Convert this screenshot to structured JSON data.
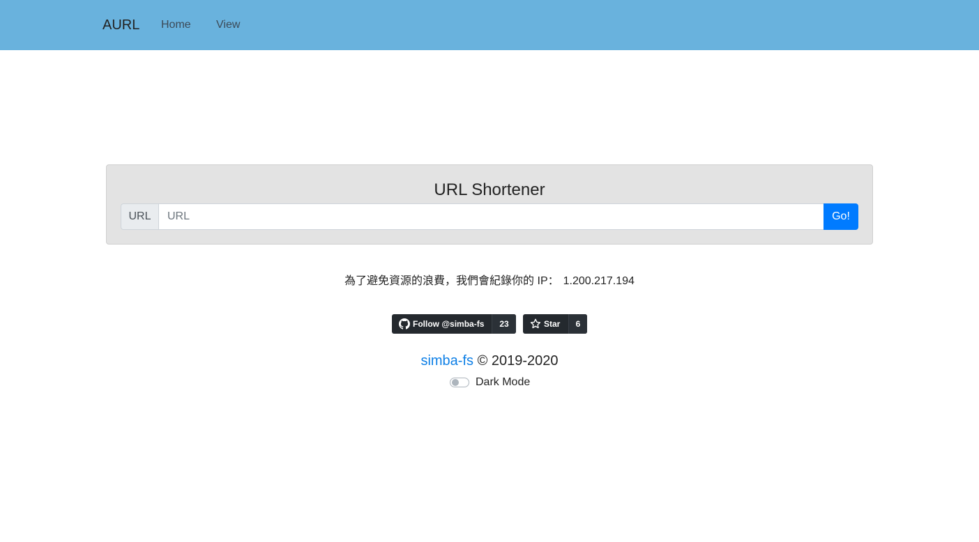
{
  "nav": {
    "brand": "AURL",
    "links": [
      "Home",
      "View"
    ]
  },
  "shortener": {
    "title": "URL Shortener",
    "prepend_label": "URL",
    "input_placeholder": "URL",
    "input_value": "",
    "button_label": "Go!"
  },
  "notice": {
    "text": "為了避免資源的浪費，我們會紀錄你的 IP：",
    "ip": "1.200.217.194"
  },
  "github": {
    "follow_label": "Follow @simba-fs",
    "follow_count": "23",
    "star_label": "Star",
    "star_count": "6",
    "follow_icon": "github-icon",
    "star_icon": "star-icon"
  },
  "footer": {
    "author_link": "simba-fs",
    "copyright": "© 2019-2020",
    "dark_mode_label": "Dark Mode",
    "dark_mode_on": false
  },
  "colors": {
    "navbar": "#69b2dd",
    "primary": "#007bff",
    "link": "#0d7fe6",
    "github_button": "#24292e"
  }
}
